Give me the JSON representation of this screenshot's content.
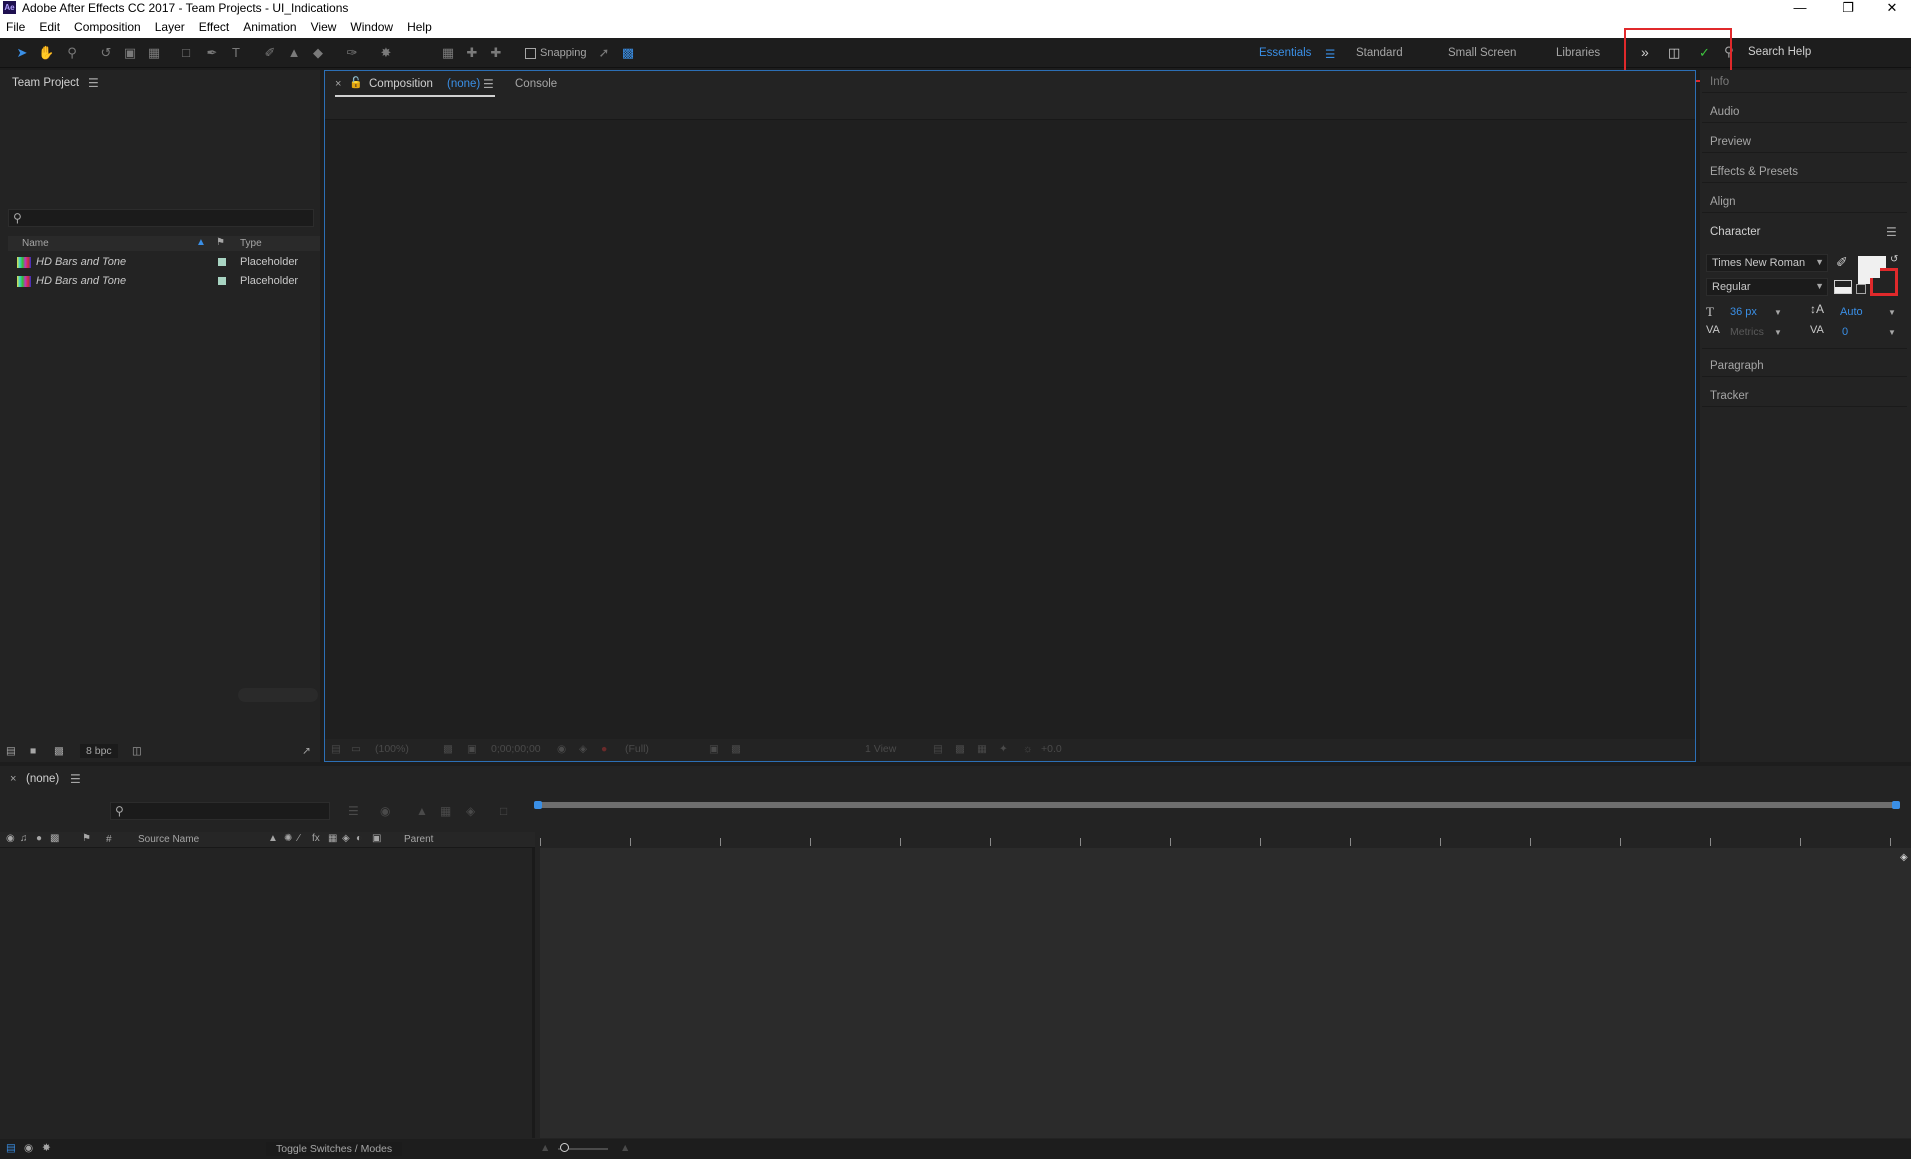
{
  "window": {
    "title": "Adobe After Effects CC 2017 - Team Projects - UI_Indications",
    "app_badge": "Ae"
  },
  "menu": [
    "File",
    "Edit",
    "Composition",
    "Layer",
    "Effect",
    "Animation",
    "View",
    "Window",
    "Help"
  ],
  "toolbar": {
    "snapping_label": "Snapping",
    "workspaces": [
      "Essentials",
      "Standard",
      "Small Screen",
      "Libraries"
    ],
    "active_workspace": "Essentials",
    "search_help_placeholder": "Search Help"
  },
  "project_panel": {
    "title": "Team Project",
    "columns": {
      "name": "Name",
      "type": "Type"
    },
    "rows": [
      {
        "name": "HD Bars and Tone",
        "type": "Placeholder"
      },
      {
        "name": "HD Bars and Tone",
        "type": "Placeholder"
      }
    ],
    "bpc": "8 bpc"
  },
  "composition_panel": {
    "tab_label": "Composition",
    "tab_value": "(none)",
    "console_tab": "Console",
    "footer": {
      "zoom": "(100%)",
      "timecode": "0;00;00;00",
      "resolution": "(Full)",
      "view": "1 View",
      "exposure": "+0.0"
    }
  },
  "right_panel": {
    "items": [
      "Info",
      "Audio",
      "Preview",
      "Effects & Presets",
      "Align"
    ],
    "character": {
      "title": "Character",
      "font": "Times New Roman",
      "style": "Regular",
      "size": "36 px",
      "leading": "Auto",
      "kerning": "Metrics",
      "tracking": "0"
    },
    "bottom_items": [
      "Paragraph",
      "Tracker"
    ]
  },
  "timeline": {
    "tab": "(none)",
    "columns": {
      "num": "#",
      "source_name": "Source Name",
      "parent": "Parent"
    },
    "footer_toggle": "Toggle Switches / Modes"
  },
  "colors": {
    "accent": "#3a8fe6",
    "highlight_box": "#e0292b",
    "panel_bg": "#232323"
  }
}
